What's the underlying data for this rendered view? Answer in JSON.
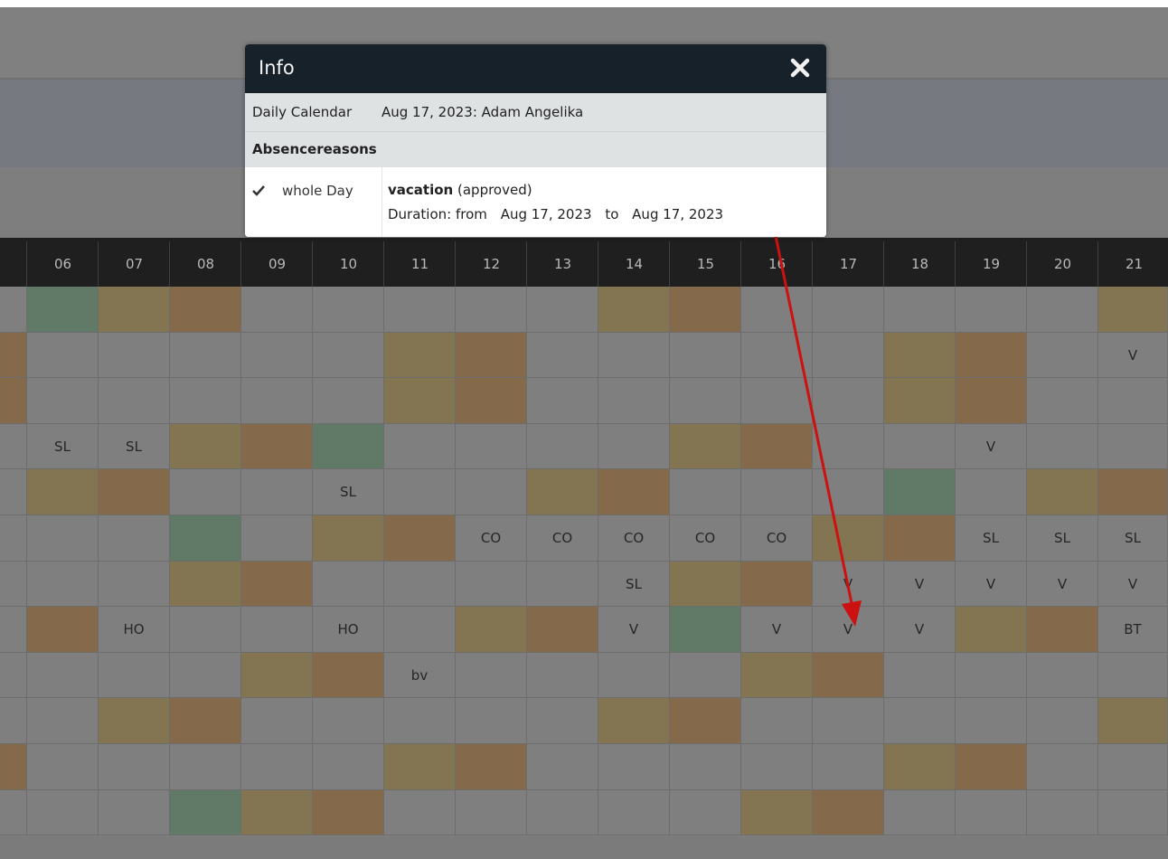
{
  "dialog": {
    "title": "Info",
    "calendar_label": "Daily Calendar",
    "calendar_info": "Aug 17, 2023: Adam Angelika",
    "section_heading": "Absencereasons",
    "scope_label": "whole Day",
    "reason_name": "vacation",
    "reason_status": "(approved)",
    "duration_label": "Duration:",
    "from_label": "from",
    "from_date": "Aug 17, 2023",
    "to_label": "to",
    "to_date": "Aug 17, 2023"
  },
  "calendar": {
    "days": [
      "06",
      "07",
      "08",
      "09",
      "10",
      "11",
      "12",
      "13",
      "14",
      "15",
      "16",
      "17",
      "18",
      "19",
      "20",
      "21"
    ],
    "rows": [
      [
        "g",
        "t",
        "b",
        "",
        "",
        "",
        "",
        "",
        "t",
        "b",
        "",
        "",
        "",
        "",
        "",
        "t"
      ],
      [
        "",
        "",
        "",
        "",
        "",
        "t",
        "b",
        "",
        "",
        "",
        "",
        "",
        "t",
        "b",
        "",
        "V"
      ],
      [
        "",
        "",
        "",
        "",
        "",
        "t",
        "b",
        "",
        "",
        "",
        "",
        "",
        "t",
        "b",
        "",
        ""
      ],
      [
        "SL",
        "SL",
        "t",
        "b",
        "g",
        "",
        "",
        "",
        "",
        "t",
        "b",
        "",
        "",
        "V",
        "",
        ""
      ],
      [
        "t",
        "b",
        "",
        "",
        "SL",
        "",
        "",
        "t",
        "b",
        "",
        "",
        "",
        "g",
        "",
        "t",
        "b"
      ],
      [
        "",
        "",
        "g",
        "",
        "t",
        "b",
        "CO",
        "CO",
        "CO",
        "CO",
        "CO",
        "t",
        "b",
        "SL",
        "SL",
        "SL"
      ],
      [
        "",
        "",
        "t",
        "b",
        "",
        "",
        "",
        "",
        "SL",
        "t",
        "b",
        "V",
        "V",
        "V",
        "V",
        "V"
      ],
      [
        "b",
        "HO",
        "",
        "",
        "HO",
        "",
        "t",
        "b",
        "V",
        "g",
        "V",
        "V",
        "V",
        "t",
        "b",
        "BT"
      ],
      [
        "",
        "",
        "",
        "t",
        "b",
        "bv",
        "",
        "",
        "",
        "",
        "t",
        "b",
        "",
        "",
        "",
        ""
      ],
      [
        "",
        "t",
        "b",
        "",
        "",
        "",
        "",
        "",
        "t",
        "b",
        "",
        "",
        "",
        "",
        "",
        "t"
      ],
      [
        "",
        "",
        "",
        "",
        "",
        "t",
        "b",
        "",
        "",
        "",
        "",
        "",
        "t",
        "b",
        "",
        ""
      ],
      [
        "",
        "",
        "g",
        "t",
        "b",
        "",
        "",
        "",
        "",
        "",
        "t",
        "b",
        "",
        "",
        "",
        ""
      ]
    ],
    "left_edge": [
      "",
      "b",
      "b",
      "",
      "",
      "",
      "",
      "",
      "",
      "",
      "b",
      ""
    ],
    "colors": {
      "t": "#837551",
      "b": "#84694a",
      "g": "#617a68",
      "empty": "#7f7f7f"
    }
  },
  "annotation": {
    "arrow_color": "#cc1111"
  }
}
